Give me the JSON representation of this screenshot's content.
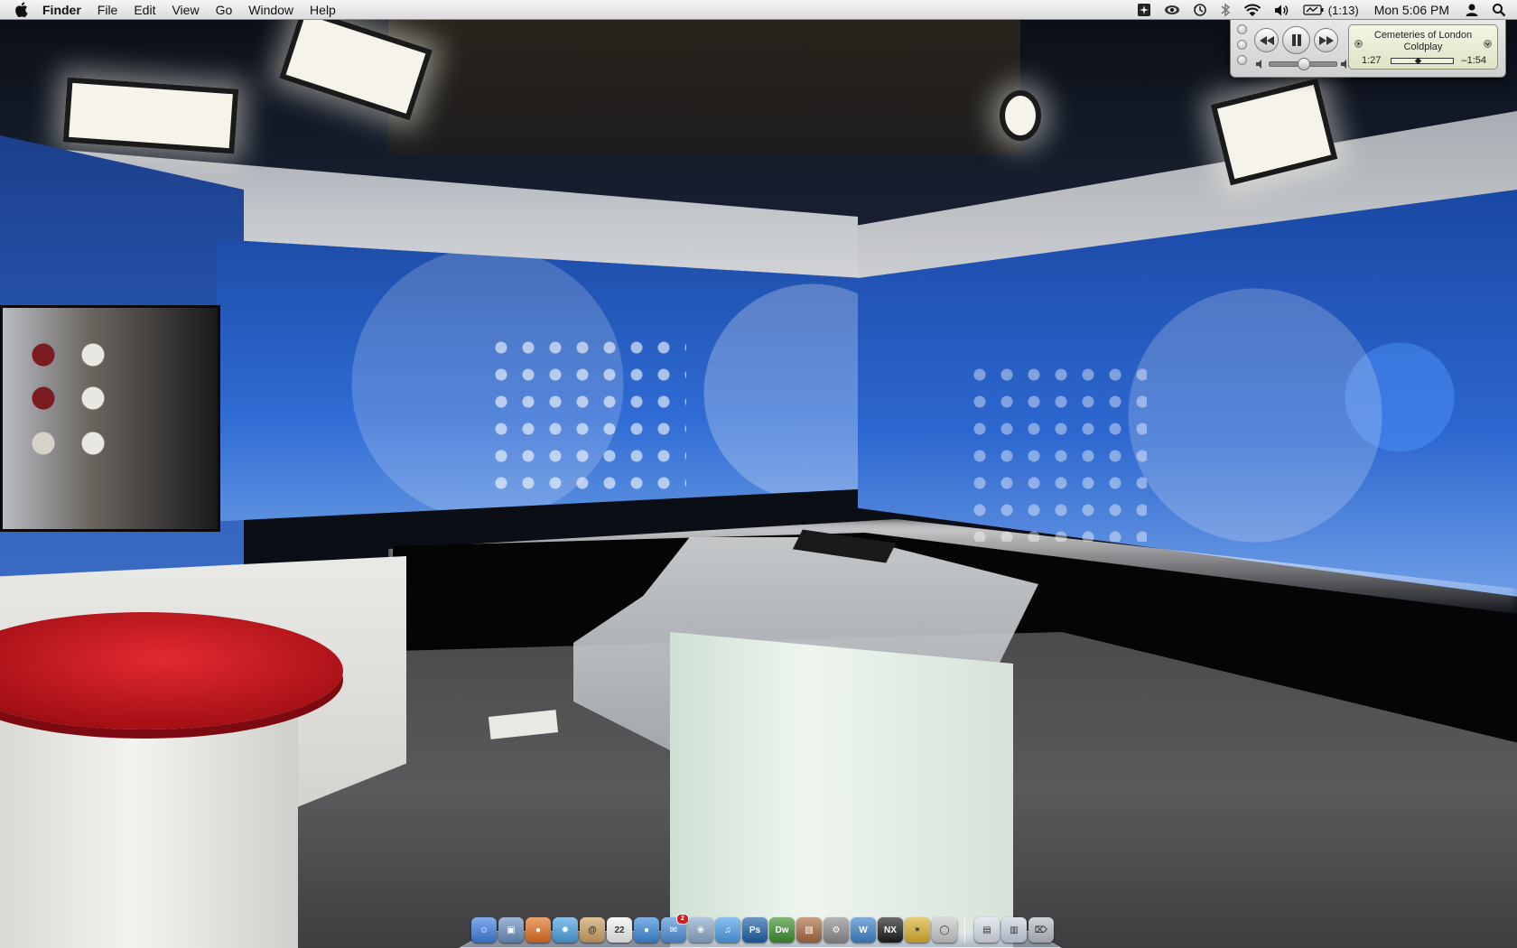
{
  "menubar": {
    "apple_icon": "apple-icon",
    "app_name": "Finder",
    "menus": [
      "File",
      "Edit",
      "View",
      "Go",
      "Window",
      "Help"
    ],
    "extras": {
      "battery_time": "(1:13)",
      "clock": "Mon 5:06 PM"
    }
  },
  "miniplayer": {
    "track_title": "Cemeteries of London",
    "artist": "Coldplay",
    "elapsed": "1:27",
    "remaining": "–1:54",
    "progress": 0.43,
    "volume": 0.5
  },
  "dock": {
    "items": [
      {
        "name": "finder",
        "bg": "#3f7fe0",
        "glyph": "☺"
      },
      {
        "name": "preview",
        "bg": "#6a8fbf",
        "glyph": "▣"
      },
      {
        "name": "firefox",
        "bg": "#e07020",
        "glyph": "●"
      },
      {
        "name": "safari",
        "bg": "#4aa0e0",
        "glyph": "✹"
      },
      {
        "name": "address-book",
        "bg": "#c9a060",
        "glyph": "@"
      },
      {
        "name": "ical",
        "bg": "#f2f2f2",
        "glyph": "22"
      },
      {
        "name": "ichat",
        "bg": "#3b89d8",
        "glyph": "●"
      },
      {
        "name": "mail",
        "bg": "#4f8fd8",
        "glyph": "✉",
        "badge": "2"
      },
      {
        "name": "iphoto",
        "bg": "#8aa8c8",
        "glyph": "❀"
      },
      {
        "name": "itunes",
        "bg": "#4d9de8",
        "glyph": "♫"
      },
      {
        "name": "photoshop",
        "bg": "#1e5fa8",
        "glyph": "Ps"
      },
      {
        "name": "dreamweaver",
        "bg": "#3d8f2d",
        "glyph": "Dw"
      },
      {
        "name": "image-app",
        "bg": "#a86a40",
        "glyph": "▧"
      },
      {
        "name": "system-preferences",
        "bg": "#8c8c8c",
        "glyph": "⚙"
      },
      {
        "name": "textwrangler",
        "bg": "#3f82c8",
        "glyph": "W"
      },
      {
        "name": "capture-nx2",
        "bg": "#1c1c1c",
        "glyph": "NX"
      },
      {
        "name": "utility-app",
        "bg": "#d8b030",
        "glyph": "✶"
      },
      {
        "name": "ipod-utility",
        "bg": "#c8c8c8",
        "glyph": "◯"
      }
    ],
    "right_items": [
      {
        "name": "documents-stack",
        "bg": "#d8dee8",
        "glyph": "▤"
      },
      {
        "name": "downloads-stack",
        "bg": "#c9d2e2",
        "glyph": "▥"
      },
      {
        "name": "trash",
        "bg": "#b8bcc4",
        "glyph": "⌦"
      }
    ]
  }
}
